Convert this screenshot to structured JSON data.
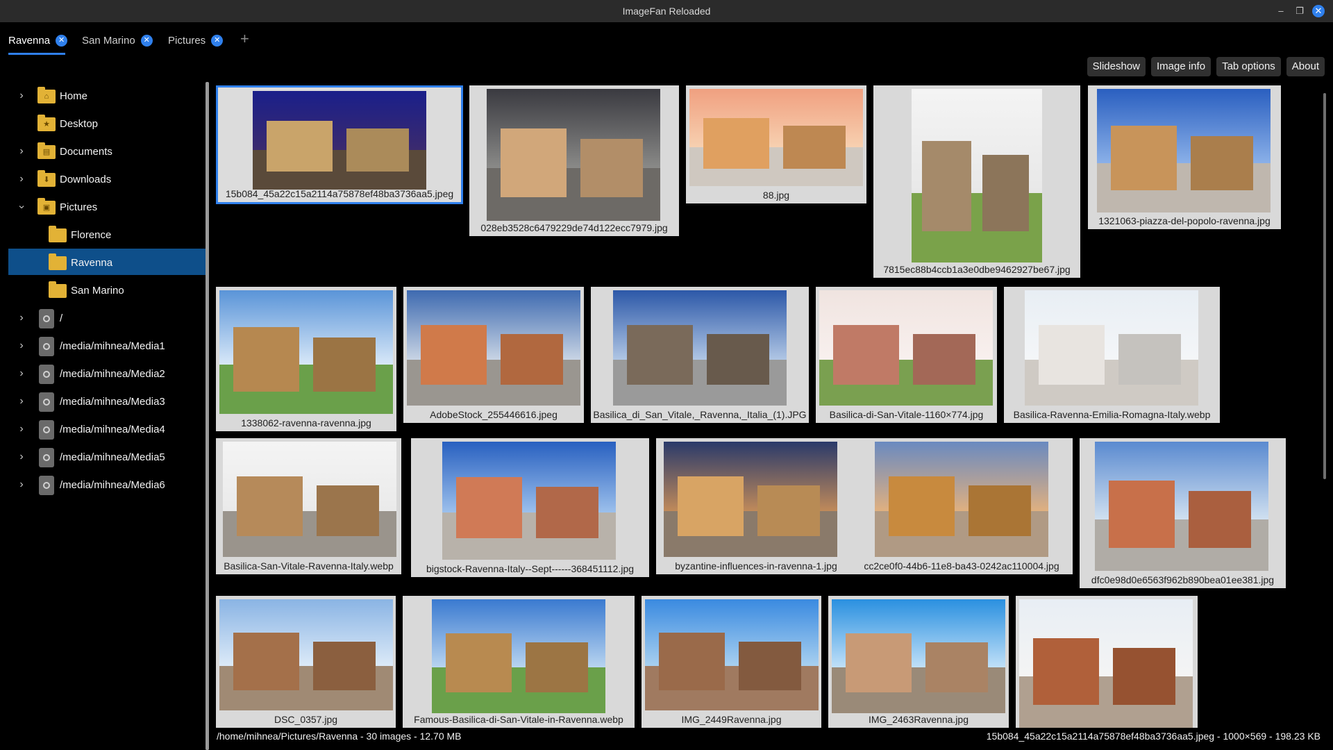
{
  "window": {
    "title": "ImageFan Reloaded"
  },
  "tabs": [
    {
      "label": "Ravenna"
    },
    {
      "label": "San Marino"
    },
    {
      "label": "Pictures"
    }
  ],
  "toolbar": {
    "slideshow": "Slideshow",
    "image_info": "Image info",
    "tab_options": "Tab options",
    "about": "About"
  },
  "sidebar": {
    "items": [
      {
        "label": "Home",
        "icon": "home-folder-icon"
      },
      {
        "label": "Desktop",
        "icon": "desktop-folder-icon"
      },
      {
        "label": "Documents",
        "icon": "documents-folder-icon"
      },
      {
        "label": "Downloads",
        "icon": "downloads-folder-icon"
      },
      {
        "label": "Pictures",
        "icon": "pictures-folder-icon"
      },
      {
        "label": "Florence",
        "icon": "folder-icon"
      },
      {
        "label": "Ravenna",
        "icon": "folder-icon"
      },
      {
        "label": "San Marino",
        "icon": "folder-icon"
      },
      {
        "label": "/",
        "icon": "drive-icon"
      },
      {
        "label": "/media/mihnea/Media1",
        "icon": "drive-icon"
      },
      {
        "label": "/media/mihnea/Media2",
        "icon": "drive-icon"
      },
      {
        "label": "/media/mihnea/Media3",
        "icon": "drive-icon"
      },
      {
        "label": "/media/mihnea/Media4",
        "icon": "drive-icon"
      },
      {
        "label": "/media/mihnea/Media5",
        "icon": "drive-icon"
      },
      {
        "label": "/media/mihnea/Media6",
        "icon": "drive-icon"
      }
    ]
  },
  "thumbnails": [
    {
      "name": "15b084_45a22c15a2114a75878ef48ba3736aa5.jpeg"
    },
    {
      "name": "028eb3528c6479229de74d122ecc7979.jpg"
    },
    {
      "name": "88.jpg"
    },
    {
      "name": "7815ec88b4ccb1a3e0dbe9462927be67.jpg"
    },
    {
      "name": "1321063-piazza-del-popolo-ravenna.jpg"
    },
    {
      "name": "1338062-ravenna-ravenna.jpg"
    },
    {
      "name": "AdobeStock_255446616.jpeg"
    },
    {
      "name": "Basilica_di_San_Vitale,_Ravenna,_Italia_(1).JPG"
    },
    {
      "name": "Basilica-di-San-Vitale-1160×774.jpg"
    },
    {
      "name": "Basilica-Ravenna-Emilia-Romagna-Italy.webp"
    },
    {
      "name": "Basilica-San-Vitale-Ravenna-Italy.webp"
    },
    {
      "name": "bigstock-Ravenna-Italy--Sept------368451112.jpg"
    },
    {
      "name": "byzantine-influences-in-ravenna-1.jpg"
    },
    {
      "name": "cc2ce0f0-44b6-11e8-ba43-0242ac110004.jpg"
    },
    {
      "name": "dfc0e98d0e6563f962b890bea01ee381.jpg"
    },
    {
      "name": "DSC_0357.jpg"
    },
    {
      "name": "Famous-Basilica-di-San-Vitale-in-Ravenna.webp"
    },
    {
      "name": "IMG_2449Ravenna.jpg"
    },
    {
      "name": "IMG_2463Ravenna.jpg"
    },
    {
      "name": ""
    }
  ],
  "status": {
    "left": "/home/mihnea/Pictures/Ravenna - 30 images - 12.70 MB",
    "right": "15b084_45a22c15a2114a75878ef48ba3736aa5.jpeg - 1000×569 - 198.23 KB"
  },
  "colors": {
    "accent": "#2f80ed",
    "selection": "#0e4f8a",
    "folder": "#e2b236"
  }
}
